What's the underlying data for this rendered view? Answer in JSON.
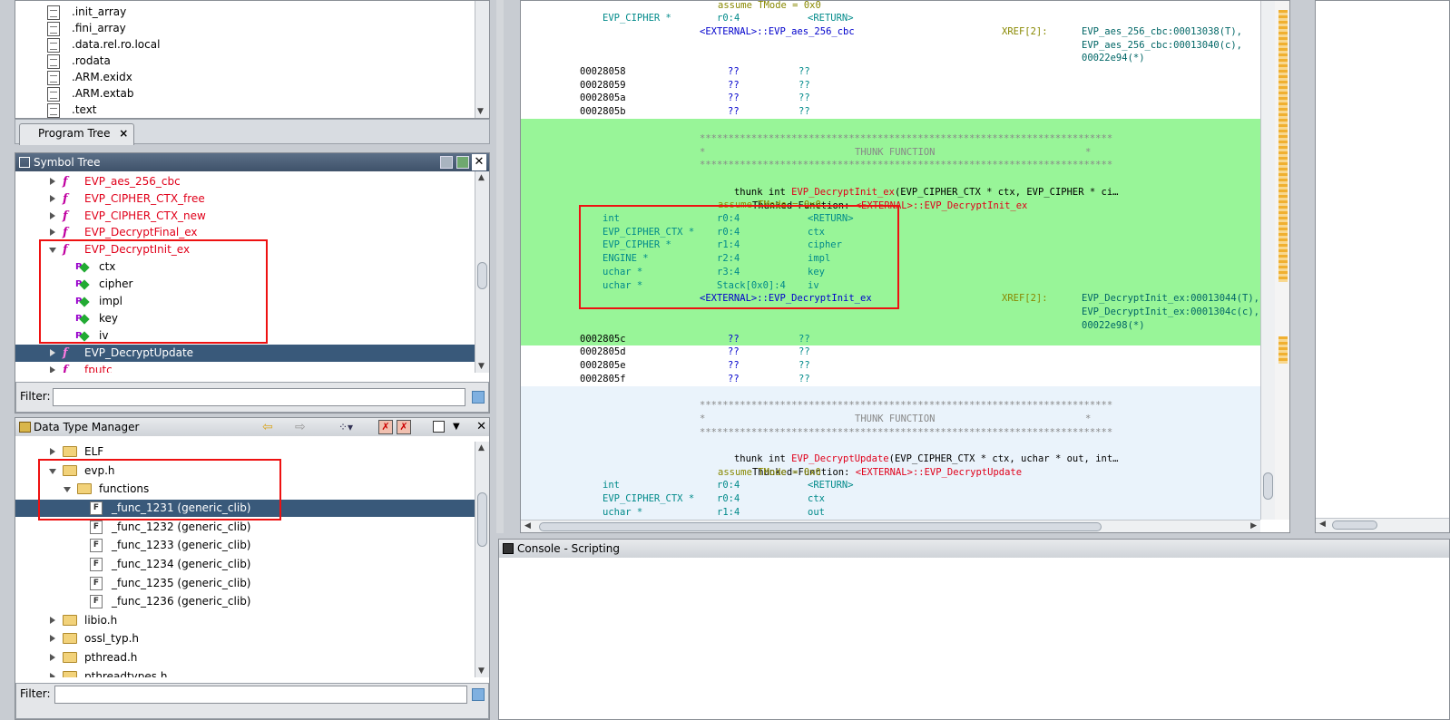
{
  "program_tree": {
    "items": [
      ".init_array",
      ".fini_array",
      ".data.rel.ro.local",
      ".rodata",
      ".ARM.exidx",
      ".ARM.extab",
      ".text"
    ],
    "tab_label": "Program Tree",
    "tab_close": "×"
  },
  "symbol_tree": {
    "title": "Symbol Tree",
    "close": "✕",
    "items": [
      {
        "label": "EVP_aes_256_cbc"
      },
      {
        "label": "EVP_CIPHER_CTX_free"
      },
      {
        "label": "EVP_CIPHER_CTX_new"
      },
      {
        "label": "EVP_DecryptFinal_ex"
      },
      {
        "label": "EVP_DecryptInit_ex"
      },
      {
        "label": "ctx"
      },
      {
        "label": "cipher"
      },
      {
        "label": "impl"
      },
      {
        "label": "key"
      },
      {
        "label": "iv"
      },
      {
        "label": "EVP_DecryptUpdate"
      },
      {
        "label": "fputc"
      }
    ],
    "filter_label": "Filter:",
    "filter_value": ""
  },
  "data_type_manager": {
    "title": "Data Type Manager",
    "close": "✕",
    "items": [
      {
        "label": "ELF"
      },
      {
        "label": "evp.h"
      },
      {
        "label": "functions"
      },
      {
        "label": "_func_1231  (generic_clib)"
      },
      {
        "label": "_func_1232  (generic_clib)"
      },
      {
        "label": "_func_1233  (generic_clib)"
      },
      {
        "label": "_func_1234  (generic_clib)"
      },
      {
        "label": "_func_1235  (generic_clib)"
      },
      {
        "label": "_func_1236  (generic_clib)"
      },
      {
        "label": "libio.h"
      },
      {
        "label": "ossl_typ.h"
      },
      {
        "label": "pthread.h"
      },
      {
        "label": "pthreadtypes.h"
      }
    ],
    "filter_label": "Filter:",
    "filter_value": ""
  },
  "listing": {
    "top": {
      "l1": "assume TMode = 0x0",
      "l2_type": "EVP_CIPHER *",
      "l2_loc": "r0:4",
      "l2_name": "<RETURN>",
      "l3_ext": "<EXTERNAL>::EVP_aes_256_cbc",
      "l3_xref": "XREF[2]:",
      "l3_ref1": "EVP_aes_256_cbc:00013038(T),",
      "l4_ref2": "EVP_aes_256_cbc:00013040(c),",
      "l5_ref3": "00022e94(*)"
    },
    "undef1": [
      {
        "addr": "00028058",
        "b": "??",
        "v": "??"
      },
      {
        "addr": "00028059",
        "b": "??",
        "v": "??"
      },
      {
        "addr": "0002805a",
        "b": "??",
        "v": "??"
      },
      {
        "addr": "0002805b",
        "b": "??",
        "v": "??"
      }
    ],
    "thunk1": {
      "stars": "************************************************************************",
      "star_left": "*",
      "label": "THUNK FUNCTION",
      "star_right": "*",
      "sig_pre": "thunk int ",
      "sig_name": "EVP_DecryptInit_ex",
      "sig_post": "(EVP_CIPHER_CTX * ctx, EVP_CIPHER * ci…",
      "thunked_label": "Thunked-Function: ",
      "thunked_target": "<EXTERNAL>::EVP_DecryptInit_ex",
      "assume": "assume TMode = 0x0",
      "params": [
        {
          "type": "int",
          "loc": "r0:4",
          "name": "<RETURN>"
        },
        {
          "type": "EVP_CIPHER_CTX *",
          "loc": "r0:4",
          "name": "ctx"
        },
        {
          "type": "EVP_CIPHER *",
          "loc": "r1:4",
          "name": "cipher"
        },
        {
          "type": "ENGINE *",
          "loc": "r2:4",
          "name": "impl"
        },
        {
          "type": "uchar *",
          "loc": "r3:4",
          "name": "key"
        },
        {
          "type": "uchar *",
          "loc": "Stack[0x0]:4",
          "name": "iv"
        }
      ],
      "ext": "<EXTERNAL>::EVP_DecryptInit_ex",
      "xref": "XREF[2]:",
      "ref1": "EVP_DecryptInit_ex:00013044(T),",
      "ref2": "EVP_DecryptInit_ex:0001304c(c),",
      "ref3": "00022e98(*)"
    },
    "undef2": [
      {
        "addr": "0002805c",
        "b": "??",
        "v": "??"
      },
      {
        "addr": "0002805d",
        "b": "??",
        "v": "??"
      },
      {
        "addr": "0002805e",
        "b": "??",
        "v": "??"
      },
      {
        "addr": "0002805f",
        "b": "??",
        "v": "??"
      }
    ],
    "thunk2": {
      "stars": "************************************************************************",
      "star_left": "*",
      "label": "THUNK FUNCTION",
      "star_right": "*",
      "sig_pre": "thunk int ",
      "sig_name": "EVP_DecryptUpdate",
      "sig_post": "(EVP_CIPHER_CTX * ctx, uchar * out, int…",
      "thunked_label": "Thunked-Function: ",
      "thunked_target": "<EXTERNAL>::EVP_DecryptUpdate",
      "assume": "assume TMode = 0x0",
      "params": [
        {
          "type": "int",
          "loc": "r0:4",
          "name": "<RETURN>"
        },
        {
          "type": "EVP_CIPHER_CTX *",
          "loc": "r0:4",
          "name": "ctx"
        },
        {
          "type": "uchar *",
          "loc": "r1:4",
          "name": "out"
        }
      ]
    }
  },
  "console": {
    "title": "Console - Scripting"
  },
  "colors": {
    "thunk_bg": "#98f598",
    "alt_bg": "#eaf3fb",
    "redbox": "#ee1111",
    "selection": "#39597a"
  }
}
